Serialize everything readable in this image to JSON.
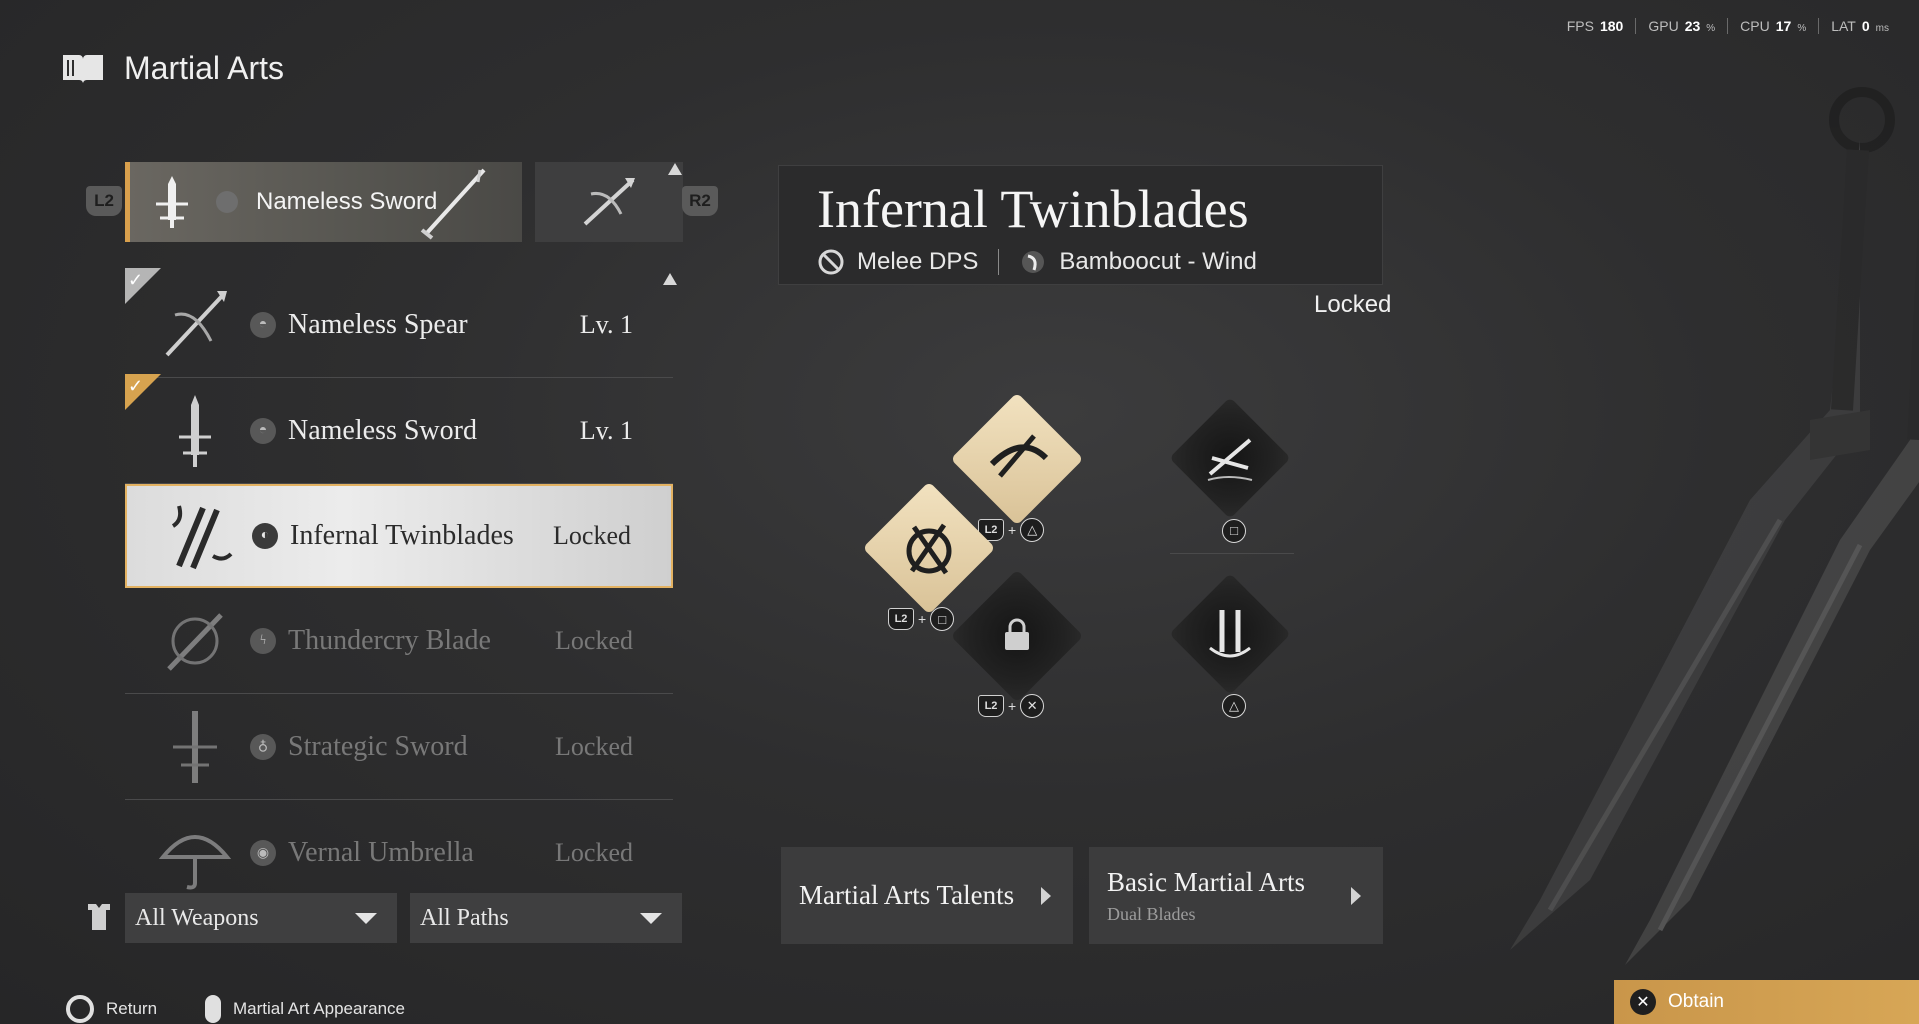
{
  "perf": {
    "fps_label": "FPS",
    "fps_value": "180",
    "gpu_label": "GPU",
    "gpu_value": "23",
    "gpu_unit": "%",
    "cpu_label": "CPU",
    "cpu_value": "17",
    "cpu_unit": "%",
    "lat_label": "LAT",
    "lat_value": "0",
    "lat_unit": "ms"
  },
  "header": {
    "title": "Martial Arts",
    "icon": "book-icon"
  },
  "weapon_tabs": {
    "left_button": "L2",
    "right_button": "R2",
    "active_label": "Nameless Sword"
  },
  "weapon_list": [
    {
      "name": "Nameless Spear",
      "status": "Lv. 1",
      "equipped": true,
      "state": "normal"
    },
    {
      "name": "Nameless Sword",
      "status": "Lv. 1",
      "equipped": true,
      "state": "normal"
    },
    {
      "name": "Infernal Twinblades",
      "status": "Locked",
      "equipped": false,
      "state": "selected"
    },
    {
      "name": "Thundercry Blade",
      "status": "Locked",
      "equipped": false,
      "state": "dim"
    },
    {
      "name": "Strategic Sword",
      "status": "Locked",
      "equipped": false,
      "state": "dim"
    },
    {
      "name": "Vernal Umbrella",
      "status": "Locked",
      "equipped": false,
      "state": "dim"
    }
  ],
  "filters": {
    "weapons": "All Weapons",
    "paths": "All Paths"
  },
  "detail": {
    "name": "Infernal Twinblades",
    "role": "Melee DPS",
    "path": "Bamboocut - Wind",
    "status": "Locked"
  },
  "skills": {
    "l2": "L2",
    "plus": "+",
    "triangle": "△",
    "square": "□",
    "cross": "✕"
  },
  "actions": {
    "talents": "Martial Arts Talents",
    "basic": "Basic Martial Arts",
    "basic_sub": "Dual Blades"
  },
  "hints": {
    "return": "Return",
    "appearance": "Martial Art Appearance",
    "obtain": "Obtain"
  },
  "colors": {
    "accent": "#d9a04d",
    "selected_border": "#e3b262",
    "skill_gold": "#e9d6b0"
  }
}
